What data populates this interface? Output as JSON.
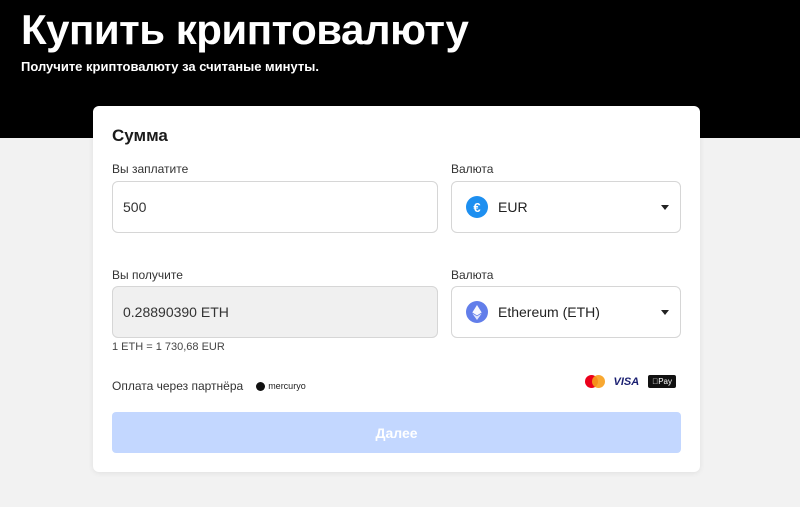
{
  "hero": {
    "title": "Купить криптовалюту",
    "subtitle": "Получите криптовалюту за считаные минуты."
  },
  "card": {
    "title": "Сумма",
    "pay": {
      "label": "Вы заплатите",
      "value": "500",
      "currency_label": "Валюта",
      "currency": "EUR",
      "currency_icon": "euro-icon",
      "currency_color": "#1d8ff0"
    },
    "receive": {
      "label": "Вы получите",
      "value": "0.28890390 ETH",
      "currency_label": "Валюта",
      "currency": "Ethereum (ETH)",
      "currency_icon": "ethereum-icon",
      "currency_color": "#627eea"
    },
    "rate": "1 ETH = 1 730,68 EUR",
    "partner_label": "Оплата через партнёра",
    "partner_name": "mercuryo",
    "payment_methods": [
      "mastercard-icon",
      "visa-icon",
      "apple-pay-icon"
    ],
    "visa_text": "VISA",
    "apple_pay_text": "Pay",
    "submit_label": "Далее",
    "submit_color": "#c3d7ff"
  }
}
